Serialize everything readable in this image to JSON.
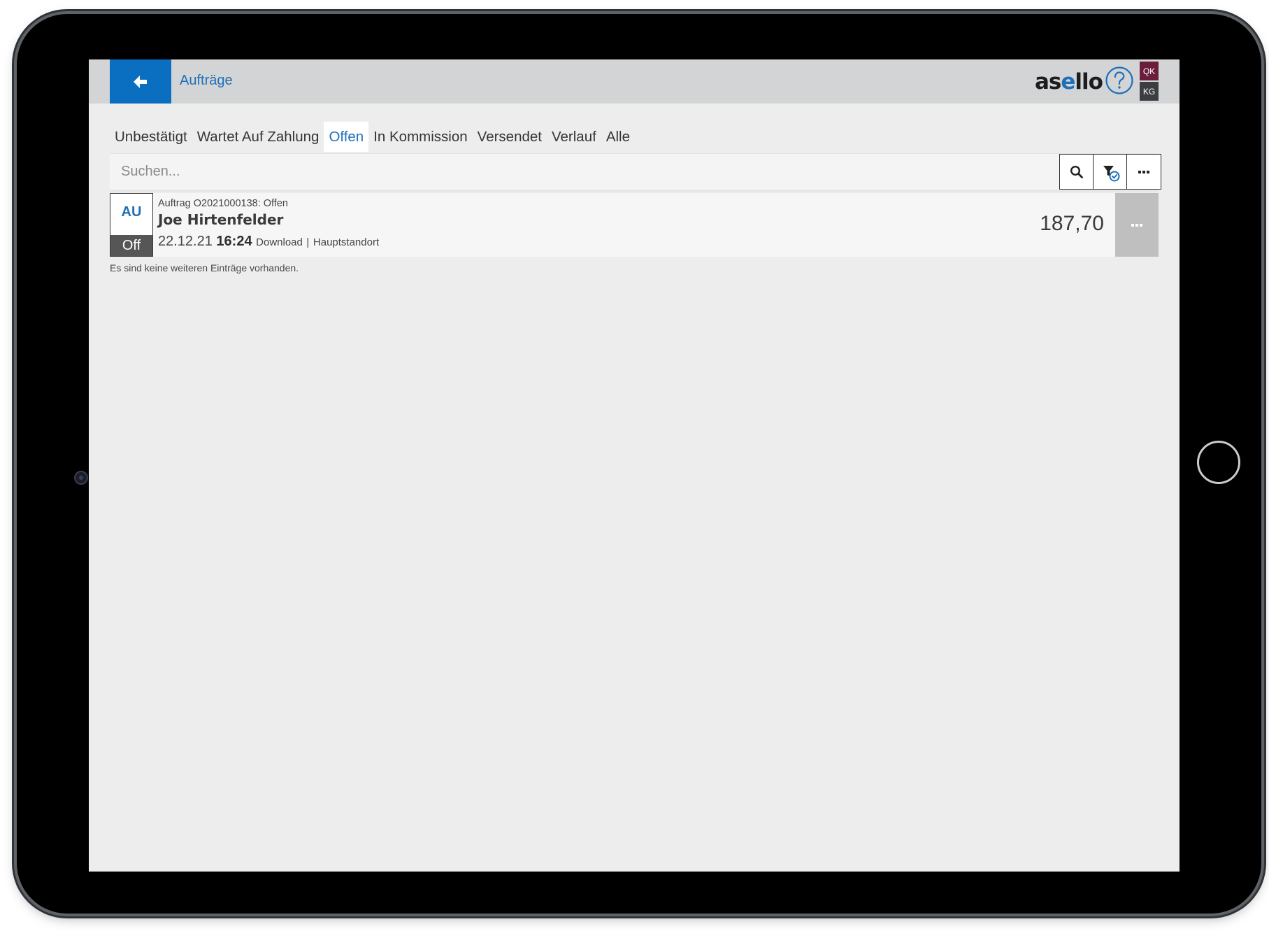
{
  "header": {
    "title": "Aufträge",
    "brand_prefix": "as",
    "brand_accent": "e",
    "brand_suffix": "llo",
    "user_initials_top": "QK",
    "user_initials_bottom": "KG",
    "accent_color": "#0b6fc1"
  },
  "tabs": [
    {
      "label": "Unbestätigt"
    },
    {
      "label": "Wartet Auf Zahlung"
    },
    {
      "label": "Offen",
      "active": true
    },
    {
      "label": "In Kommission"
    },
    {
      "label": "Versendet"
    },
    {
      "label": "Verlauf"
    },
    {
      "label": "Alle"
    }
  ],
  "search": {
    "placeholder": "Suchen...",
    "value": ""
  },
  "orders": [
    {
      "type_code": "AU",
      "status_short": "Off",
      "meta": "Auftrag O2021000138: Offen",
      "customer": "Joe Hirtenfelder",
      "date": "22.12.21",
      "time": "16:24",
      "channel": "Download",
      "separator": "|",
      "location": "Hauptstandort",
      "amount": "187,70"
    }
  ],
  "list_footer": "Es sind keine weiteren Einträge vorhanden."
}
